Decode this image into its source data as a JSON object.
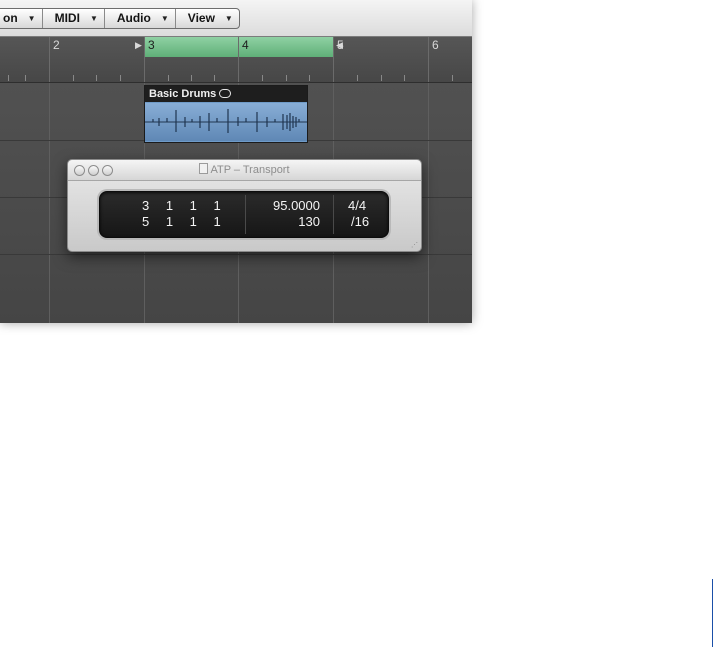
{
  "menu": {
    "items": [
      {
        "label": "on",
        "arrow": "▼"
      },
      {
        "label": "MIDI",
        "arrow": "▼"
      },
      {
        "label": "Audio",
        "arrow": "▼"
      },
      {
        "label": "View",
        "arrow": "▼"
      }
    ]
  },
  "ruler": {
    "bars": [
      "2",
      "3",
      "4",
      "5",
      "6"
    ]
  },
  "region": {
    "name": "Basic Drums"
  },
  "transport": {
    "title": "ATP – Transport",
    "position_top": "3 1 1 1",
    "position_bottom": "5 1 1 1",
    "tempo": "95.0000",
    "tempo_bottom": "130",
    "signature": "4/4",
    "division": "/16"
  },
  "colors": {
    "cycle_green": "#6fbf88",
    "region_blue": "#6f9bc8",
    "page_edge": "#1a4fa8"
  }
}
